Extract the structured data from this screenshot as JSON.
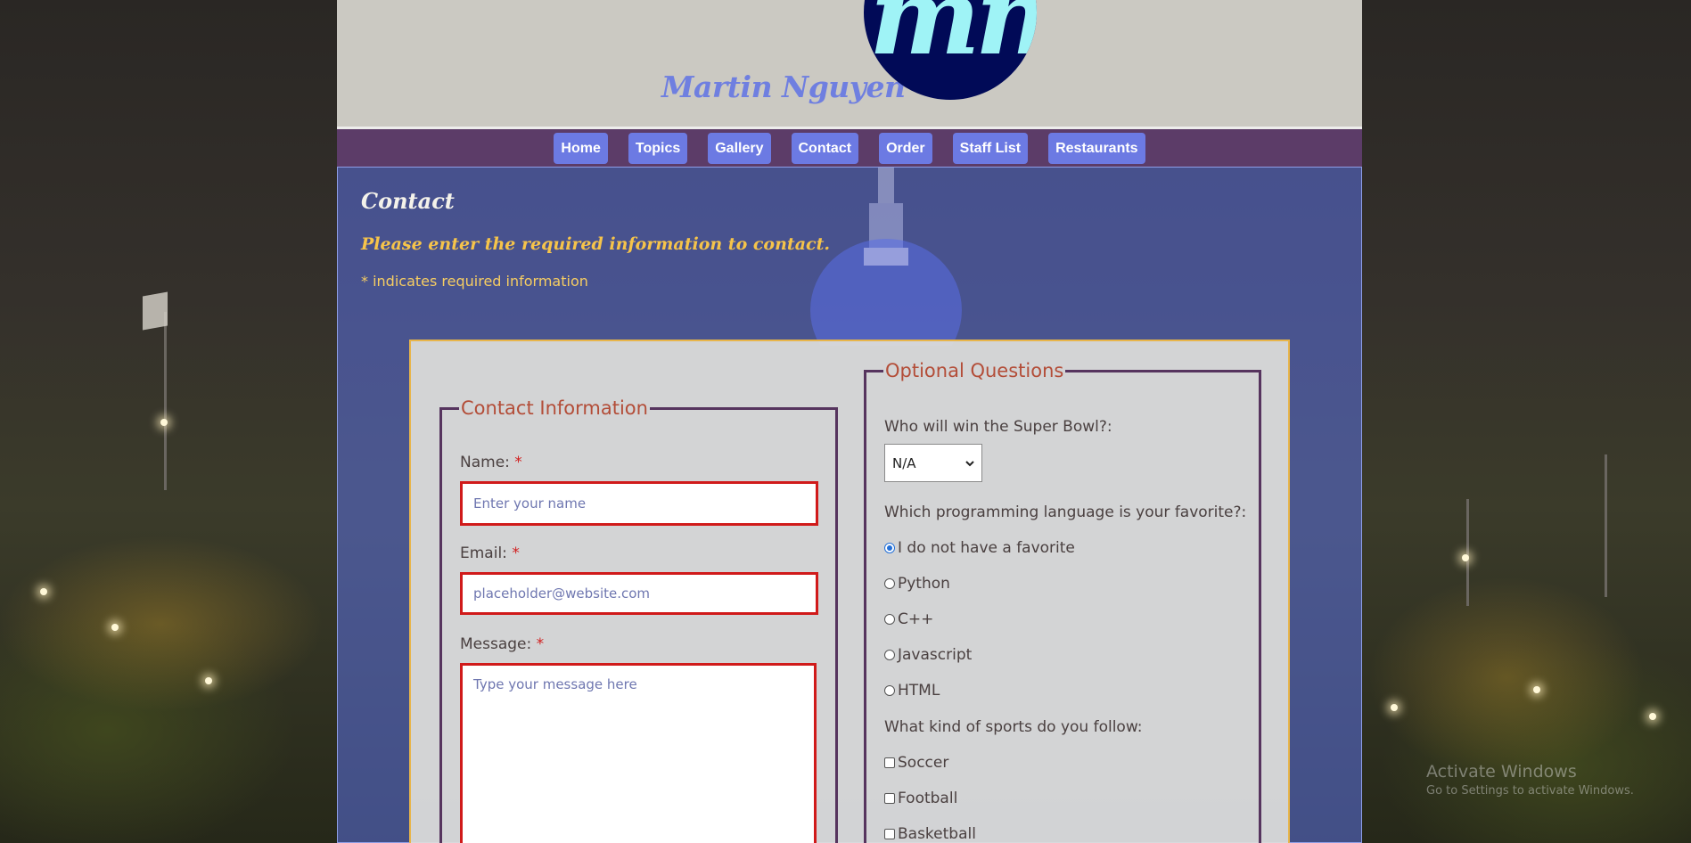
{
  "header": {
    "site_name": "Martin Nguyen",
    "logo_text": "mn"
  },
  "nav": {
    "items": [
      "Home",
      "Topics",
      "Gallery",
      "Contact",
      "Order",
      "Staff List",
      "Restaurants"
    ]
  },
  "main": {
    "title": "Contact",
    "subtitle": "Please enter the required information to contact.",
    "required_note": "* indicates required information"
  },
  "contact_form": {
    "legend": "Contact Information",
    "name_label": "Name:",
    "name_placeholder": "Enter your name",
    "email_label": "Email:",
    "email_placeholder": "placeholder@website.com",
    "message_label": "Message:",
    "message_placeholder": "Type your message here",
    "required_marker": "*"
  },
  "optional": {
    "legend": "Optional Questions",
    "superbowl_question": "Who will win the Super Bowl?:",
    "superbowl_selected": "N/A",
    "language_question": "Which programming language is your favorite?:",
    "languages": [
      "I do not have a favorite",
      "Python",
      "C++",
      "Javascript",
      "HTML"
    ],
    "language_selected": "I do not have a favorite",
    "sports_question": "What kind of sports do you follow:",
    "sports": [
      "Soccer",
      "Football",
      "Basketball"
    ]
  },
  "os_watermark": {
    "line1": "Activate Windows",
    "line2": "Go to Settings to activate Windows."
  },
  "colors": {
    "accent_blue": "#6c7ae3",
    "nav_bg": "#5c3c68",
    "logo_bg": "#010a57",
    "legend_red": "#b34d38",
    "required_red": "#d01a1a",
    "subtitle_gold": "#f6c44a"
  }
}
